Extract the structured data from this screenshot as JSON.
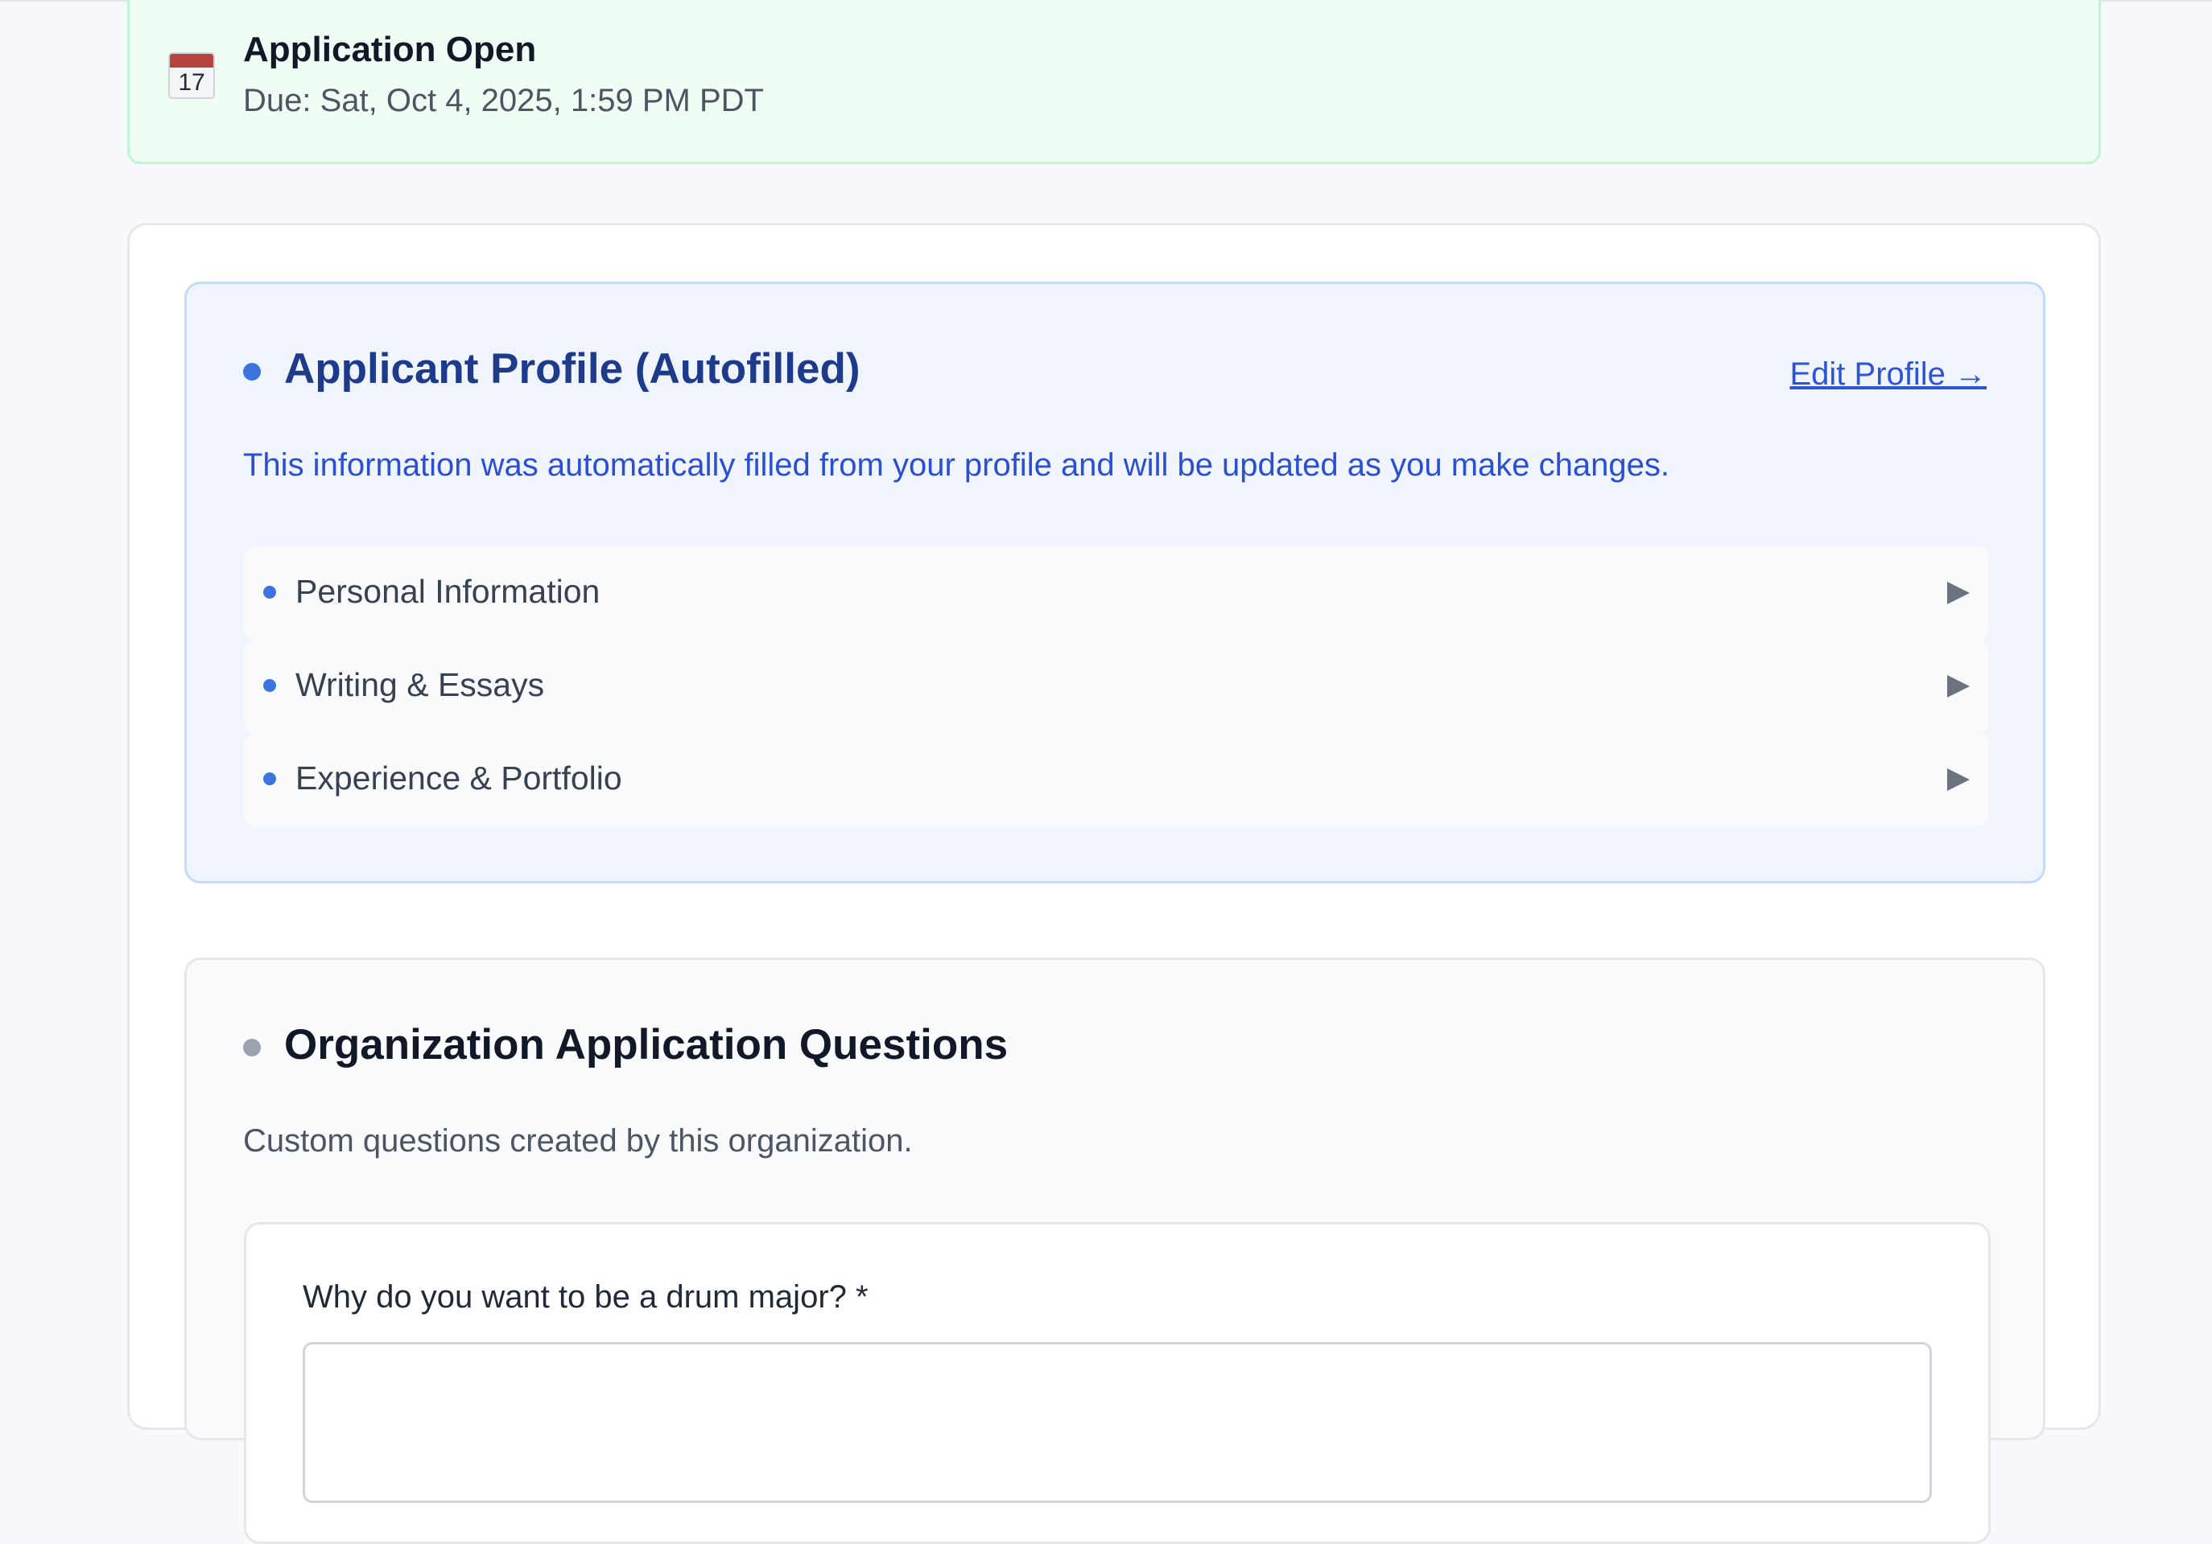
{
  "status_banner": {
    "icon_month": "JUL",
    "icon_day": "17",
    "title": "Application Open",
    "due": "Due: Sat, Oct 4, 2025, 1:59 PM PDT",
    "colors": {
      "background": "#f0fdf4",
      "border": "#bbf7d0"
    }
  },
  "profile_section": {
    "title": "Applicant Profile (Autofilled)",
    "edit_link": "Edit Profile →",
    "description": "This information was automatically filled from your profile and will be updated as you make changes.",
    "items": [
      {
        "label": "Personal Information"
      },
      {
        "label": "Writing & Essays"
      },
      {
        "label": "Experience & Portfolio"
      }
    ],
    "colors": {
      "accent": "#3b74e0",
      "title": "#1e3a8a",
      "description": "#2b4fd0"
    }
  },
  "org_section": {
    "title": "Organization Application Questions",
    "description": "Custom questions created by this organization.",
    "questions": [
      {
        "label": "Why do you want to be a drum major? *",
        "value": ""
      }
    ],
    "colors": {
      "dot": "#9ca3af"
    }
  }
}
